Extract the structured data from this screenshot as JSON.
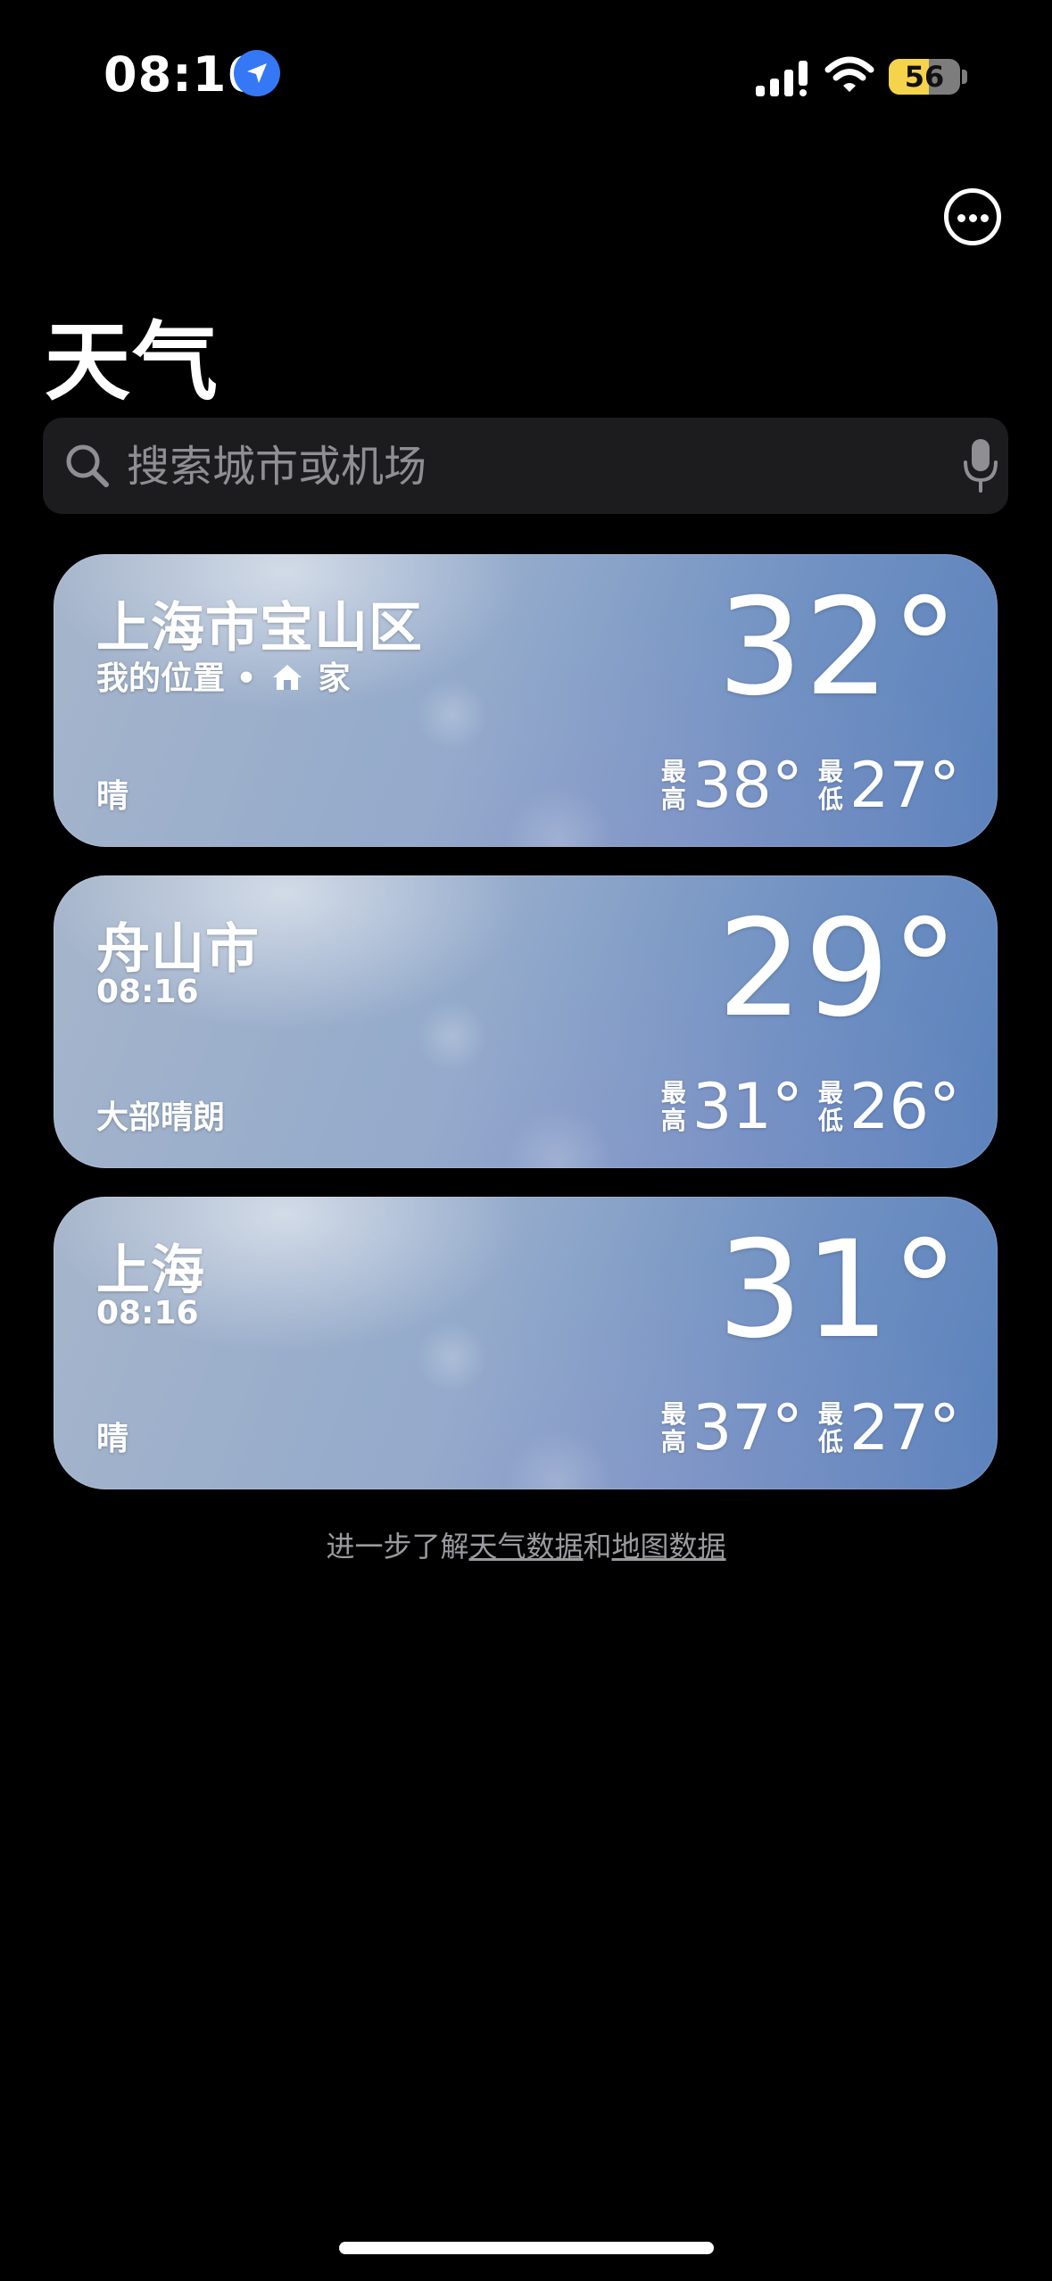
{
  "status_bar": {
    "time": "08:16",
    "battery_level": "56",
    "battery_fraction": 0.56,
    "icons": [
      "location-arrow-icon",
      "cellular-signal-icon",
      "wifi-icon",
      "battery-icon"
    ]
  },
  "header": {
    "title": "天气",
    "more_icon": "ellipsis-circle-icon"
  },
  "search": {
    "placeholder": "搜索城市或机场",
    "value": "",
    "icons": [
      "search-icon",
      "microphone-icon"
    ]
  },
  "cities": [
    {
      "name": "上海市宝山区",
      "subtitle_prefix": "我的位置 •",
      "subtitle_icon": "home-icon",
      "subtitle_suffix": "家",
      "temp": "32°",
      "condition": "晴",
      "high_label": "最高",
      "high": "38°",
      "low_label": "最低",
      "low": "27°"
    },
    {
      "name": "舟山市",
      "subtitle": "08:16",
      "temp": "29°",
      "condition": "大部晴朗",
      "high_label": "最高",
      "high": "31°",
      "low_label": "最低",
      "low": "26°"
    },
    {
      "name": "上海",
      "subtitle": "08:16",
      "temp": "31°",
      "condition": "晴",
      "high_label": "最高",
      "high": "37°",
      "low_label": "最低",
      "low": "27°"
    }
  ],
  "footer": {
    "prefix": "进一步了解",
    "weather_data_link": "天气数据",
    "conjunction": "和",
    "map_data_link": "地图数据"
  },
  "colors": {
    "background": "#000000",
    "search_background": "#1c1c1e",
    "location_blue": "#3478f6",
    "battery_yellow": "#f5d34a",
    "card_blue": "#6f90c2"
  }
}
